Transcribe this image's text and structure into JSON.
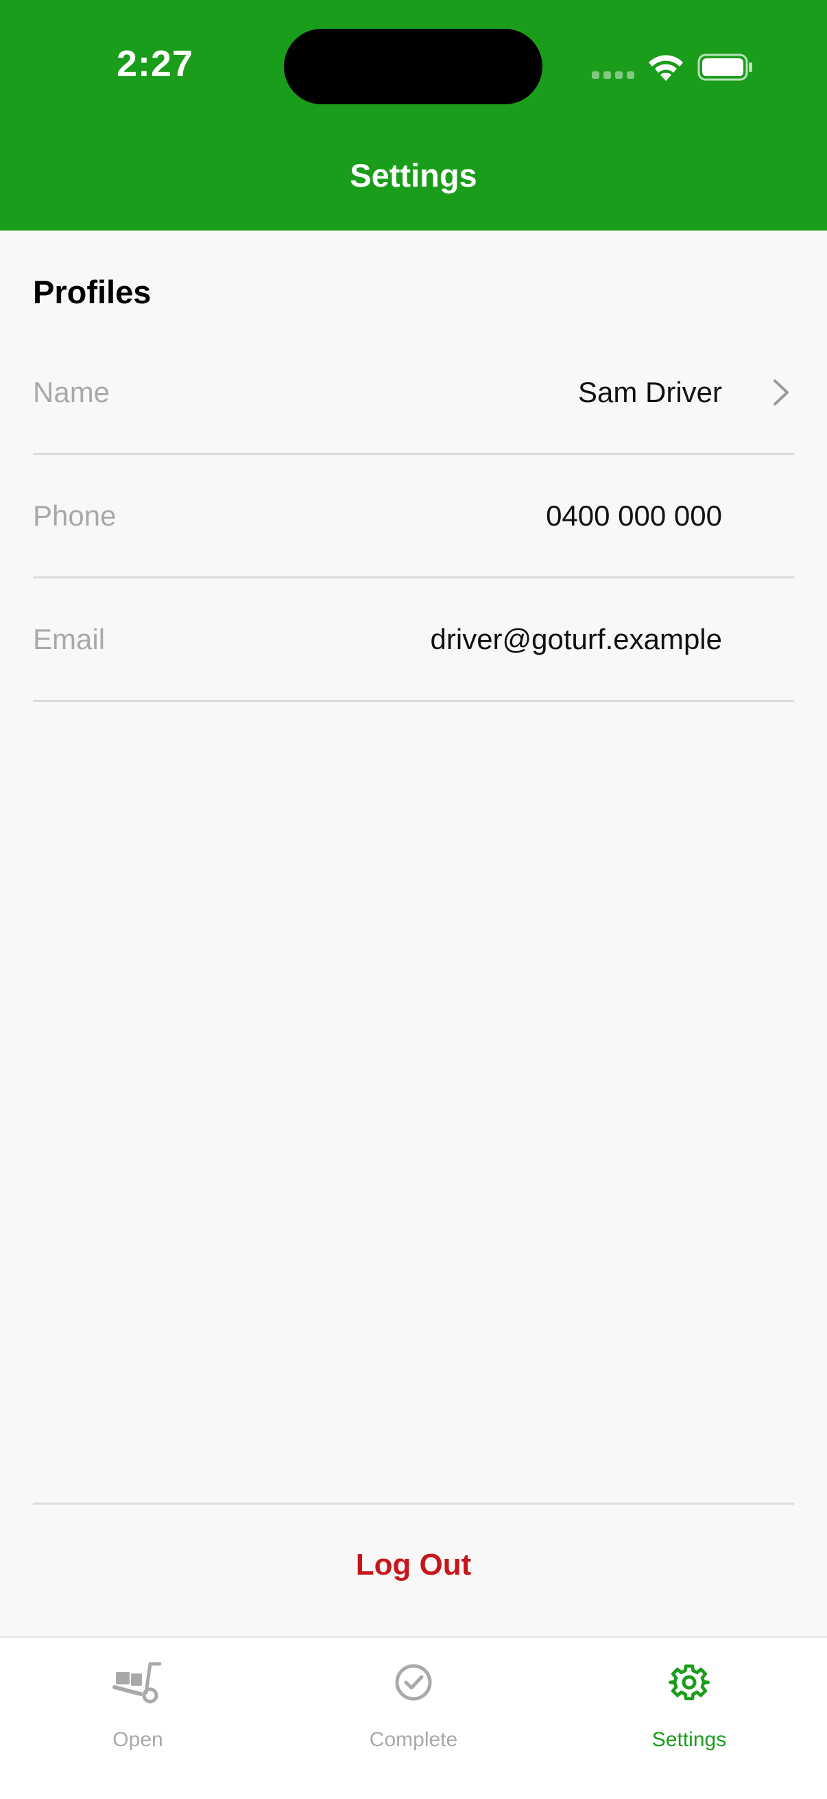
{
  "status_bar": {
    "time": "2:27"
  },
  "nav": {
    "title": "Settings"
  },
  "profile": {
    "section_title": "Profiles",
    "rows": [
      {
        "label": "Name",
        "value": "Sam Driver",
        "chevron": "chevron-right-icon"
      },
      {
        "label": "Phone",
        "value": "0400 000 000"
      },
      {
        "label": "Email",
        "value": "driver@goturf.example"
      }
    ]
  },
  "logout_label": "Log Out",
  "tabs": [
    {
      "label": "Open",
      "icon": "hand-truck-icon",
      "active": false
    },
    {
      "label": "Complete",
      "icon": "check-circle-icon",
      "active": false
    },
    {
      "label": "Settings",
      "icon": "gear-icon",
      "active": true
    }
  ],
  "colors": {
    "brand_green": "#1a9d1b",
    "logout_red": "#c8151b",
    "inactive_gray": "#a9a9a9"
  }
}
